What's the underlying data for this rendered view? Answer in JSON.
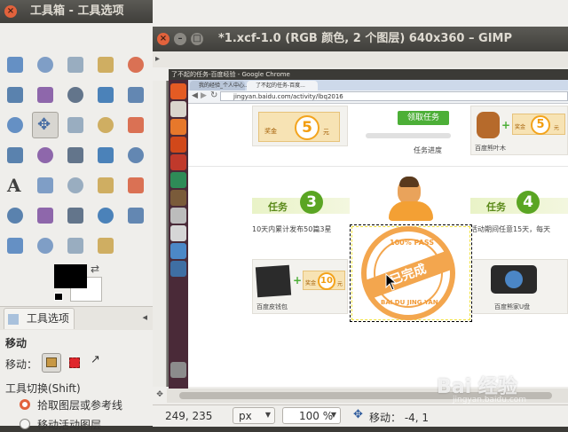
{
  "toolbox": {
    "title": "工具箱 - 工具选项",
    "tools": [
      "rect-select",
      "ellipse-select",
      "free-select",
      "fuzzy-select",
      "color-select",
      "scissors-select",
      "foreground-select",
      "paths",
      "color-picker",
      "zoom",
      "measure",
      "move",
      "align",
      "crop",
      "rotate",
      "scale",
      "shear",
      "perspective",
      "flip",
      "cage-transform",
      "text",
      "bucket-fill",
      "blend",
      "pencil",
      "paintbrush",
      "eraser",
      "airbrush",
      "ink",
      "clone",
      "heal",
      "perspective-clone",
      "blur",
      "smudge",
      "dodge-burn"
    ],
    "selected_tool": "move",
    "fg_color": "#000000",
    "bg_color": "#ffffff",
    "options_tab": "工具选项",
    "options_heading": "移动",
    "move_label": "移动：",
    "switch_label": "工具切换(Shift)",
    "radio_pick": "拾取图层或参考线",
    "radio_active": "移动活动图层"
  },
  "image_window": {
    "title": "*1.xcf-1.0 (RGB 颜色, 2 个图层) 640x360 – GIMP",
    "status": {
      "coords": "249, 235",
      "unit": "px",
      "zoom": "100 %",
      "move_info": "移动：  -4, 1"
    }
  },
  "embedded": {
    "chrome_title": "了不起的任务-百度经验 - Google Chrome",
    "tabs": [
      "我的经验_个人中心...",
      "了不起的任务-百度..."
    ],
    "url": "jingyan.baidu.com/activity/lbq2016",
    "reward_label": "奖金",
    "reward_unit": "元",
    "reward_5": "5",
    "reward_10": "10",
    "claim_button": "领取任务",
    "progress_label": "任务进度",
    "prize_1": "百度熊叶木",
    "task3_label": "任务",
    "task3_num": "3",
    "task4_label": "任务",
    "task4_num": "4",
    "task3_desc": "10天内累计发布50篇3星",
    "task4_desc": "活动期间任意15天，每天",
    "prize_2": "百度皮钱包",
    "prize_3": "百度熊家U盘",
    "stamp_top": "100% PASS",
    "stamp_mid": "已完成",
    "stamp_bottom": "BAI DU JING YAN"
  },
  "watermark": "Bai 经验",
  "watermark_sub": "jingyan.baidu.com"
}
